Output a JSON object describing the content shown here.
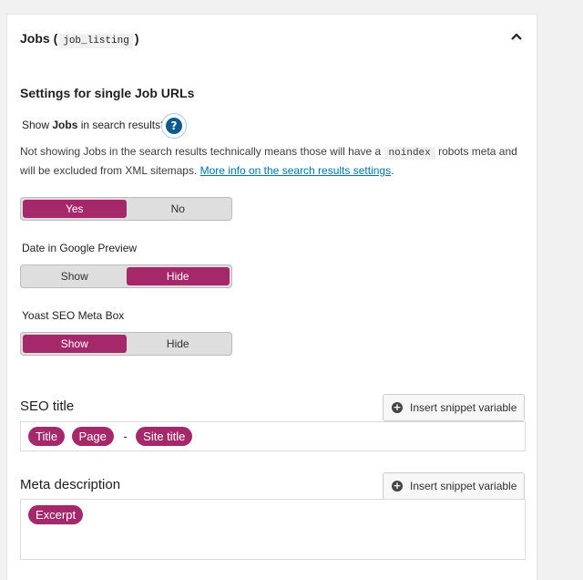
{
  "header": {
    "title": "Jobs (",
    "code": "job_listing",
    "title_end": ")",
    "collapse_icon": "chevron-up-icon"
  },
  "section": {
    "title": "Settings for single Job URLs"
  },
  "search_results": {
    "label_pre": "Show ",
    "label_bold": "Jobs",
    "label_post": " in search results?",
    "help_icon": "question-icon",
    "help_glyph": "?",
    "desc_1": "Not showing Jobs in the search results technically means those will have a ",
    "desc_code": "noindex",
    "desc_2": " robots meta and will be excluded from XML sitemaps. ",
    "desc_link": "More info on the search results settings",
    "desc_end": ".",
    "options": [
      "Yes",
      "No"
    ],
    "selected": "Yes"
  },
  "date_preview": {
    "label": "Date in Google Preview",
    "options": [
      "Show",
      "Hide"
    ],
    "selected": "Hide"
  },
  "meta_box": {
    "label": "Yoast SEO Meta Box",
    "options": [
      "Show",
      "Hide"
    ],
    "selected": "Show"
  },
  "seo_title": {
    "label": "SEO title",
    "button": "Insert snippet variable",
    "tokens": [
      "Title",
      "Page",
      "Site title"
    ],
    "separator": "-"
  },
  "meta_description": {
    "label": "Meta description",
    "button": "Insert snippet variable",
    "tokens": [
      "Excerpt"
    ]
  },
  "colors": {
    "accent": "#a4286a",
    "link": "#0073aa",
    "help": "#0a5a8c"
  }
}
